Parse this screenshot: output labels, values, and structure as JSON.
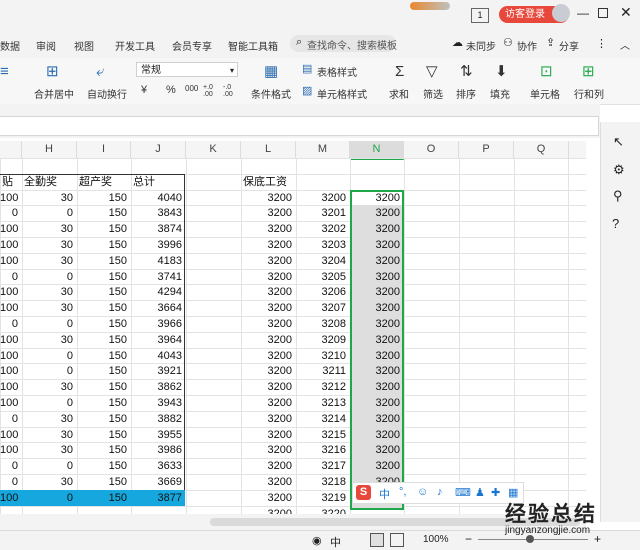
{
  "titlebar": {
    "page_indicator": "1",
    "login_label": "访客登录"
  },
  "tabs": [
    "数据",
    "审阅",
    "视图",
    "开发工具",
    "会员专享",
    "智能工具箱"
  ],
  "search": {
    "placeholder": "查找命令、搜索模板"
  },
  "account": {
    "sync_label": "未同步",
    "collab_label": "协作",
    "share_label": "分享"
  },
  "ribbon": {
    "merge_center": "合并居中",
    "auto_wrap": "自动换行",
    "number_format": "常规",
    "currency": "¥",
    "percent": "%",
    "thousands": "000",
    "inc_decimal": "+.0 .00",
    "dec_decimal": "-.0 .00",
    "conditional_format": "条件格式",
    "table_style": "表格样式",
    "cell_style": "单元格样式",
    "sum": "求和",
    "filter": "筛选",
    "sort": "排序",
    "fill": "填充",
    "cell": "单元格",
    "row_col": "行和列"
  },
  "columns": [
    "H",
    "I",
    "J",
    "K",
    "L",
    "M",
    "N",
    "O",
    "P",
    "Q"
  ],
  "table": {
    "headers": [
      "贴",
      "全勤奖",
      "超产奖",
      "总计"
    ],
    "rows": [
      [
        "100",
        "30",
        "150",
        "4040"
      ],
      [
        "0",
        "0",
        "150",
        "3843"
      ],
      [
        "100",
        "30",
        "150",
        "3874"
      ],
      [
        "100",
        "30",
        "150",
        "3996"
      ],
      [
        "100",
        "30",
        "150",
        "4183"
      ],
      [
        "0",
        "0",
        "150",
        "3741"
      ],
      [
        "100",
        "30",
        "150",
        "4294"
      ],
      [
        "100",
        "30",
        "150",
        "3664"
      ],
      [
        "0",
        "0",
        "150",
        "3966"
      ],
      [
        "100",
        "30",
        "150",
        "3964"
      ],
      [
        "100",
        "0",
        "150",
        "4043"
      ],
      [
        "100",
        "0",
        "150",
        "3921"
      ],
      [
        "100",
        "30",
        "150",
        "3862"
      ],
      [
        "100",
        "0",
        "150",
        "3943"
      ],
      [
        "0",
        "30",
        "150",
        "3882"
      ],
      [
        "100",
        "30",
        "150",
        "3955"
      ],
      [
        "100",
        "30",
        "150",
        "3986"
      ],
      [
        "0",
        "0",
        "150",
        "3633"
      ],
      [
        "0",
        "30",
        "150",
        "3669"
      ],
      [
        "100",
        "0",
        "150",
        "3877"
      ]
    ]
  },
  "salary": {
    "header": "保底工资",
    "col_l": [
      "3200",
      "3200",
      "3200",
      "3200",
      "3200",
      "3200",
      "3200",
      "3200",
      "3200",
      "3200",
      "3200",
      "3200",
      "3200",
      "3200",
      "3200",
      "3200",
      "3200",
      "3200",
      "3200",
      "3200",
      "3200"
    ],
    "col_m": [
      "3200",
      "3201",
      "3202",
      "3203",
      "3204",
      "3205",
      "3206",
      "3207",
      "3208",
      "3209",
      "3210",
      "3211",
      "3212",
      "3213",
      "3214",
      "3215",
      "3216",
      "3217",
      "3218",
      "3219",
      "3220",
      "3221"
    ],
    "col_n": [
      "3200",
      "3200",
      "3200",
      "3200",
      "3200",
      "3200",
      "3200",
      "3200",
      "3200",
      "3200",
      "3200",
      "3200",
      "3200",
      "3200",
      "3200",
      "3200",
      "3200",
      "3200",
      "3200",
      "3200"
    ]
  },
  "ime": {
    "logo": "S",
    "lang": "中",
    "punct": "°,"
  },
  "status": {
    "zoom": "100%",
    "view_mode": "中"
  },
  "watermark": {
    "cn": "经验总结",
    "url": "jingyanzongjie.com"
  },
  "colors": {
    "accent": "#1fa84a",
    "login": "#e8473b",
    "fill_blue": "#16a7de"
  }
}
